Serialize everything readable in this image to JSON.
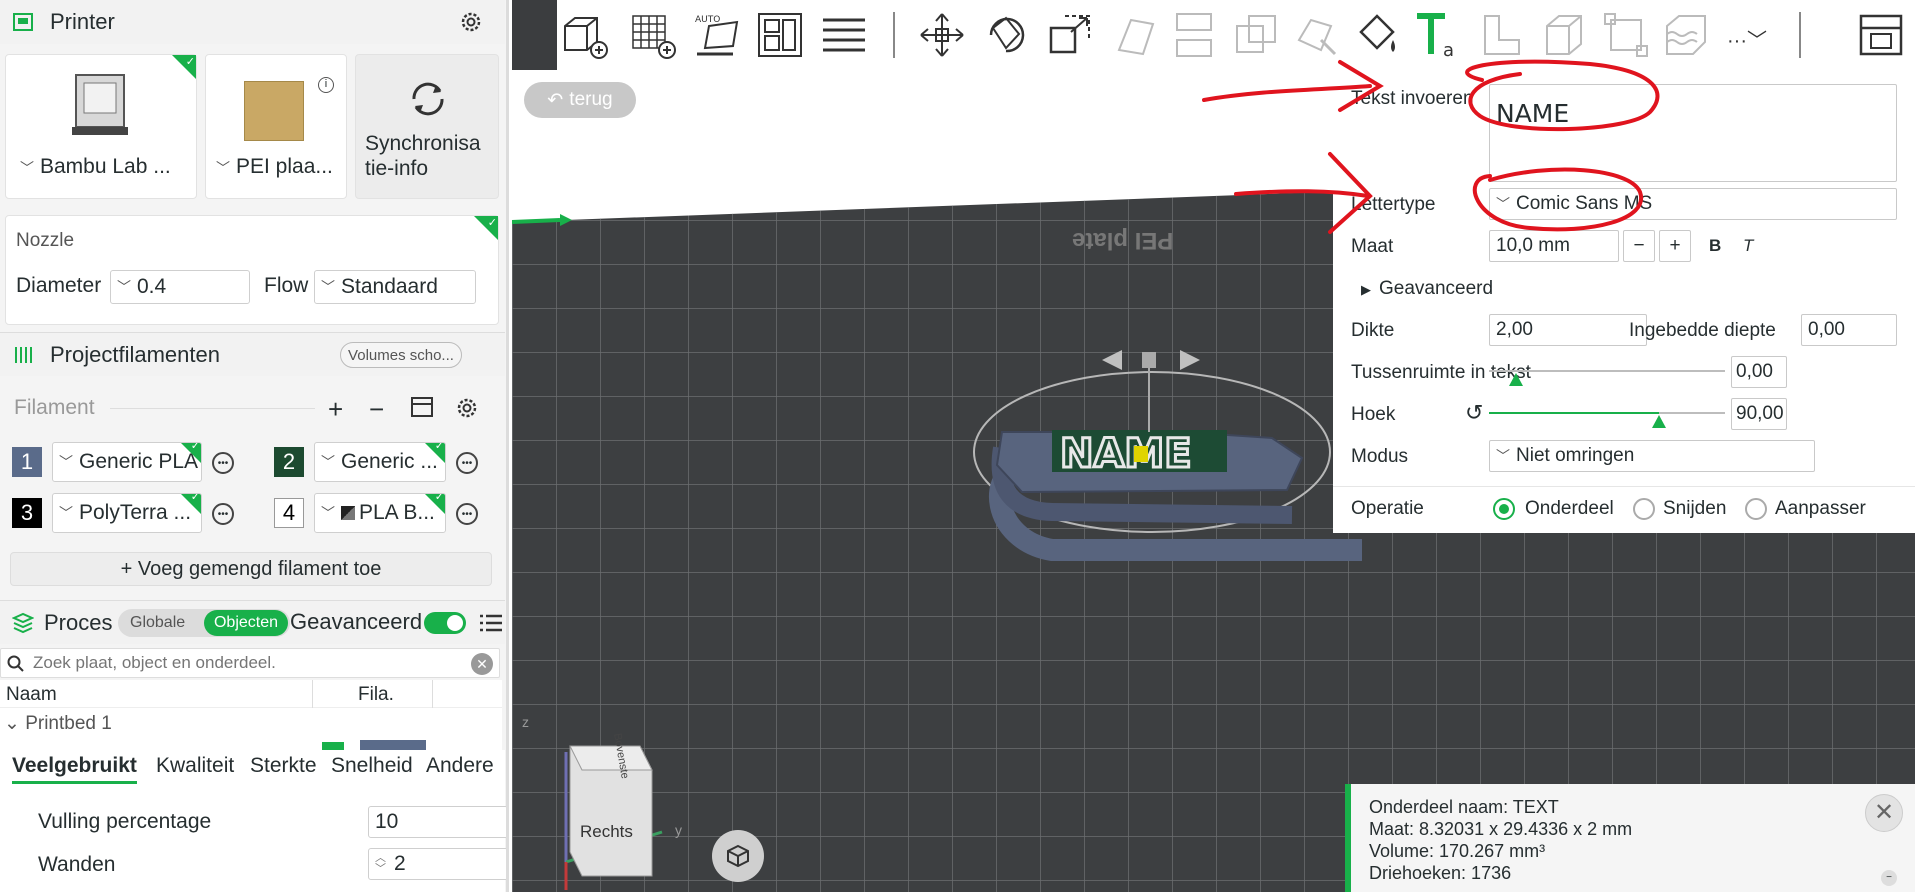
{
  "printer": {
    "section_title": "Printer",
    "printer_name": "Bambu Lab ...",
    "plate_name": "PEI plaa...",
    "sync_label": "Synchronisa tie-info"
  },
  "nozzle": {
    "title": "Nozzle",
    "diameter_label": "Diameter",
    "diameter_value": "0.4",
    "flow_label": "Flow",
    "flow_value": "Standaard"
  },
  "filaments": {
    "section_title": "Projectfilamenten",
    "volumes_button": "Volumes scho...",
    "filament_label": "Filament",
    "items": [
      {
        "num": "1",
        "name": "Generic PLA",
        "color": "#5a6b8a"
      },
      {
        "num": "2",
        "name": "Generic ...",
        "color": "#1c4a30"
      },
      {
        "num": "3",
        "name": "PolyTerra ...",
        "color": "#000000"
      },
      {
        "num": "4",
        "name": "PLA B...",
        "color": "#ffffff"
      }
    ],
    "add_mixed": "+ Voeg gemengd filament toe"
  },
  "process": {
    "section_title": "Proces",
    "toggle_global": "Globale",
    "toggle_objects": "Objecten",
    "advanced_label": "Geavanceerd",
    "search_placeholder": "Zoek plaat, object en onderdeel.",
    "col_name": "Naam",
    "col_fila": "Fila.",
    "tree_item": "Printbed 1",
    "tabs": [
      "Veelgebruikt",
      "Kwaliteit",
      "Sterkte",
      "Snelheid",
      "Andere"
    ],
    "infill_label": "Vulling percentage",
    "infill_value": "10",
    "walls_label": "Wanden",
    "walls_value": "2"
  },
  "viewport": {
    "back_button": "terug",
    "plate_text": "PEI plate",
    "text_on_object": "NAME",
    "cube_top": "Bovenste",
    "cube_front": "Rechts",
    "axis_z": "z",
    "axis_y": "y"
  },
  "text_panel": {
    "text_label": "Tekst invoeren",
    "text_value": "NAME",
    "font_label": "Lettertype",
    "font_value": "Comic Sans MS",
    "size_label": "Maat",
    "size_value": "10,0 mm",
    "bold": "B",
    "italic": "T",
    "advanced": "Geavanceerd",
    "thickness_label": "Dikte",
    "thickness_value": "2,00",
    "embed_label": "Ingebedde diepte",
    "embed_value": "0,00",
    "spacing_label": "Tussenruimte in tekst",
    "spacing_value": "0,00",
    "angle_label": "Hoek",
    "angle_value": "90,00",
    "mode_label": "Modus",
    "mode_value": "Niet omringen",
    "operation_label": "Operatie",
    "op_part": "Onderdeel",
    "op_cut": "Snijden",
    "op_modify": "Aanpasser"
  },
  "info": {
    "name": "Onderdeel naam: TEXT",
    "size": "Maat: 8.32031 x 29.4336 x 2 mm",
    "volume": "Volume: 170.267 mm³",
    "triangles": "Driehoeken: 1736"
  },
  "colors": {
    "accent": "#18b04a",
    "annotation": "#e0141e",
    "viewport_bg": "#3b3d3f"
  }
}
